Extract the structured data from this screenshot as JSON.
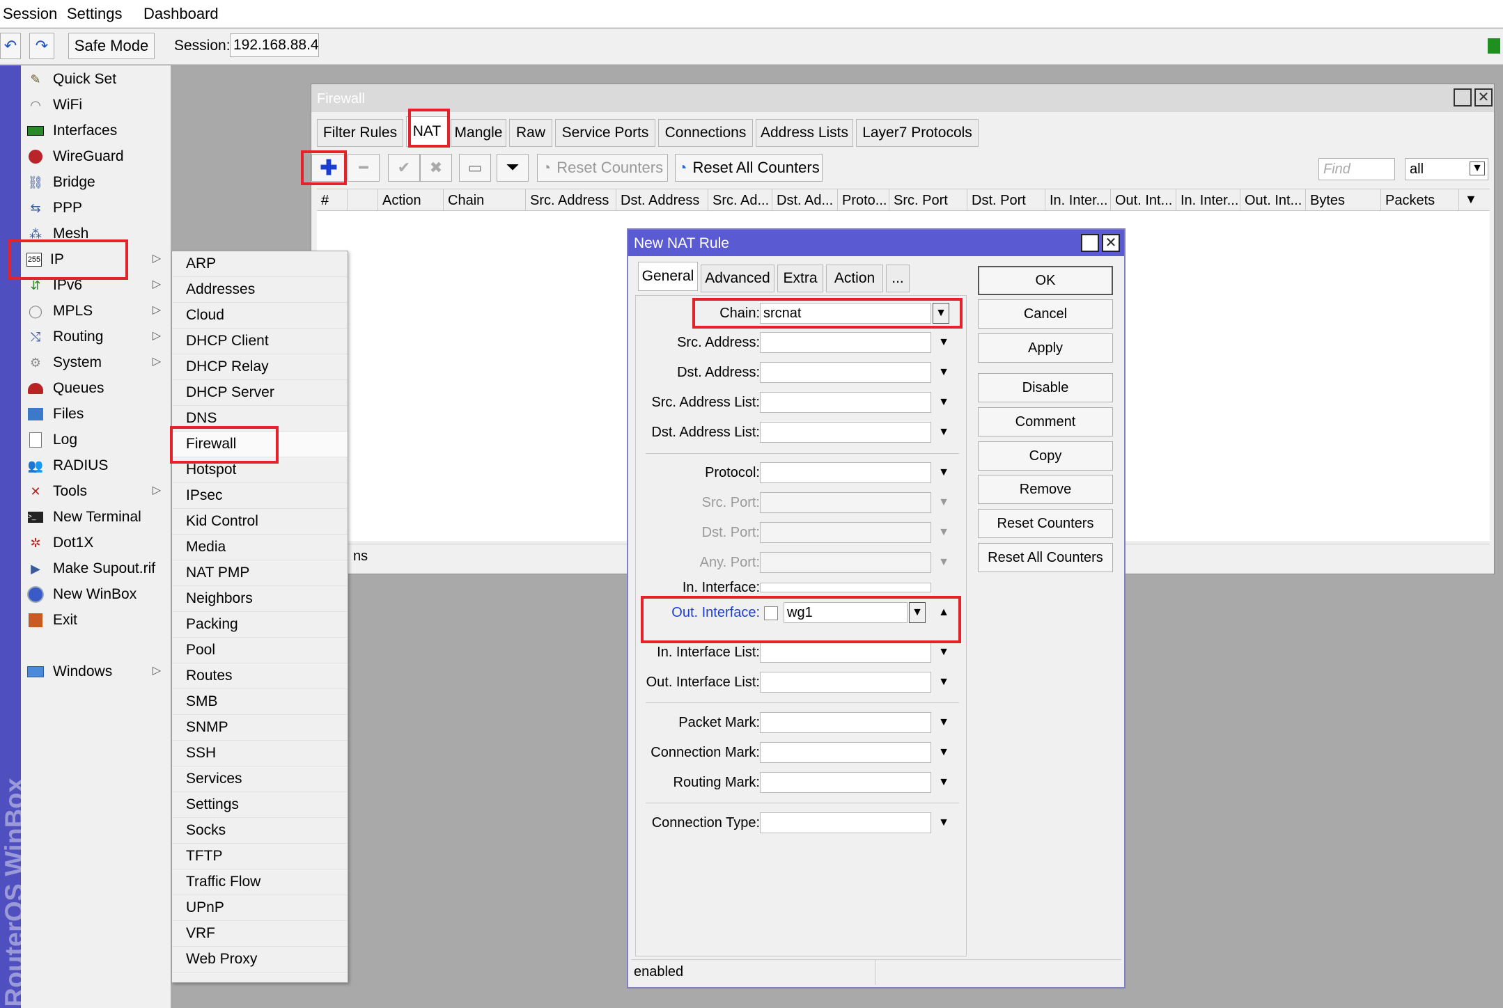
{
  "menubar": {
    "items": [
      "Session",
      "Settings",
      "Dashboard"
    ]
  },
  "toolbar": {
    "undo_icon": "undo-icon",
    "redo_icon": "redo-icon",
    "safe_mode": "Safe Mode",
    "session_label": "Session:",
    "session_value": "192.168.88.4"
  },
  "side_brand": "RouterOS WinBox",
  "sidebar": {
    "items": [
      {
        "label": "Quick Set",
        "icon": "quick-set-icon"
      },
      {
        "label": "WiFi",
        "icon": "wifi-icon"
      },
      {
        "label": "Interfaces",
        "icon": "interfaces-icon"
      },
      {
        "label": "WireGuard",
        "icon": "wireguard-icon"
      },
      {
        "label": "Bridge",
        "icon": "bridge-icon"
      },
      {
        "label": "PPP",
        "icon": "ppp-icon"
      },
      {
        "label": "Mesh",
        "icon": "mesh-icon"
      },
      {
        "label": "IP",
        "icon": "ip-icon"
      },
      {
        "label": "IPv6",
        "icon": "ipv6-icon"
      },
      {
        "label": "MPLS",
        "icon": "mpls-icon"
      },
      {
        "label": "Routing",
        "icon": "routing-icon"
      },
      {
        "label": "System",
        "icon": "system-icon"
      },
      {
        "label": "Queues",
        "icon": "queues-icon"
      },
      {
        "label": "Files",
        "icon": "files-icon"
      },
      {
        "label": "Log",
        "icon": "log-icon"
      },
      {
        "label": "RADIUS",
        "icon": "radius-icon"
      },
      {
        "label": "Tools",
        "icon": "tools-icon"
      },
      {
        "label": "New Terminal",
        "icon": "terminal-icon"
      },
      {
        "label": "Dot1X",
        "icon": "dot1x-icon"
      },
      {
        "label": "Make Supout.rif",
        "icon": "supout-icon"
      },
      {
        "label": "New WinBox",
        "icon": "winbox-icon"
      },
      {
        "label": "Exit",
        "icon": "exit-icon"
      },
      {
        "label": "Windows",
        "icon": "windows-icon"
      }
    ]
  },
  "ip_submenu": [
    "ARP",
    "Addresses",
    "Cloud",
    "DHCP Client",
    "DHCP Relay",
    "DHCP Server",
    "DNS",
    "Firewall",
    "Hotspot",
    "IPsec",
    "Kid Control",
    "Media",
    "NAT PMP",
    "Neighbors",
    "Packing",
    "Pool",
    "Routes",
    "SMB",
    "SNMP",
    "SSH",
    "Services",
    "Settings",
    "Socks",
    "TFTP",
    "Traffic Flow",
    "UPnP",
    "VRF",
    "Web Proxy"
  ],
  "firewall": {
    "title": "Firewall",
    "tabs": [
      "Filter Rules",
      "NAT",
      "Mangle",
      "Raw",
      "Service Ports",
      "Connections",
      "Address Lists",
      "Layer7 Protocols"
    ],
    "reset_counters": "Reset Counters",
    "reset_all_counters": "Reset All Counters",
    "find_placeholder": "Find",
    "filter_value": "all",
    "columns": [
      "#",
      "",
      "Action",
      "Chain",
      "Src. Address",
      "Dst. Address",
      "Src. Ad...",
      "Dst. Ad...",
      "Proto...",
      "Src. Port",
      "Dst. Port",
      "In. Inter...",
      "Out. Int...",
      "In. Inter...",
      "Out. Int...",
      "Bytes",
      "Packets"
    ],
    "status_fragment": "ns"
  },
  "nat_dialog": {
    "title": "New NAT Rule",
    "tabs": [
      "General",
      "Advanced",
      "Extra",
      "Action",
      "..."
    ],
    "fields": {
      "chain": {
        "label": "Chain:",
        "value": "srcnat"
      },
      "src_address": "Src. Address:",
      "dst_address": "Dst. Address:",
      "src_address_list": "Src. Address List:",
      "dst_address_list": "Dst. Address List:",
      "protocol": "Protocol:",
      "src_port": "Src. Port:",
      "dst_port": "Dst. Port:",
      "any_port": "Any. Port:",
      "in_interface": "In. Interface:",
      "out_interface": {
        "label": "Out. Interface:",
        "value": "wg1"
      },
      "in_interface_list": "In. Interface List:",
      "out_interface_list": "Out. Interface List:",
      "packet_mark": "Packet Mark:",
      "connection_mark": "Connection Mark:",
      "routing_mark": "Routing Mark:",
      "connection_type": "Connection Type:"
    },
    "buttons": [
      "OK",
      "Cancel",
      "Apply",
      "Disable",
      "Comment",
      "Copy",
      "Remove",
      "Reset Counters",
      "Reset All Counters"
    ],
    "status": "enabled"
  },
  "colors": {
    "highlight": "#e4222a",
    "title_active": "#5a5ad2",
    "side_strip": "#4f4fbf",
    "link_blue": "#1f3fd0"
  }
}
